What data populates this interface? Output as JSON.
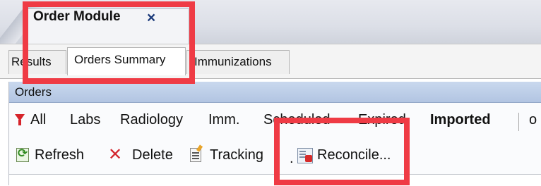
{
  "window": {
    "document_tab": {
      "title": "Order Module",
      "close_glyph": "×"
    }
  },
  "subtabs": [
    {
      "label": "Results",
      "active": false
    },
    {
      "label": "Orders Summary",
      "active": true
    },
    {
      "label": "Immunizations",
      "active": false
    }
  ],
  "orders_panel": {
    "title": "Orders",
    "filter_icon": "funnel-icon",
    "filters": [
      {
        "label": "All",
        "bold": false
      },
      {
        "label": "Labs",
        "bold": false
      },
      {
        "label": "Radiology",
        "bold": false
      },
      {
        "label": "Imm.",
        "bold": false
      },
      {
        "label": "Scheduled",
        "bold": false
      },
      {
        "label": "Expired",
        "bold": false
      },
      {
        "label": "Imported",
        "bold": true
      },
      {
        "label": "o",
        "bold": false
      }
    ],
    "toolbar": {
      "refresh": {
        "label": "Refresh",
        "icon": "refresh-icon"
      },
      "delete": {
        "label": "Delete",
        "icon": "delete-x-icon"
      },
      "tracking": {
        "label": "Tracking",
        "icon": "tracking-icon"
      },
      "separator_text": ".",
      "reconcile": {
        "label": "Reconcile...",
        "icon": "reconcile-icon"
      }
    }
  },
  "colors": {
    "highlight": "#ef3b45",
    "panel_header": "#c0d1ea",
    "delete_icon": "#d3262e",
    "filter_icon": "#d6242b"
  }
}
